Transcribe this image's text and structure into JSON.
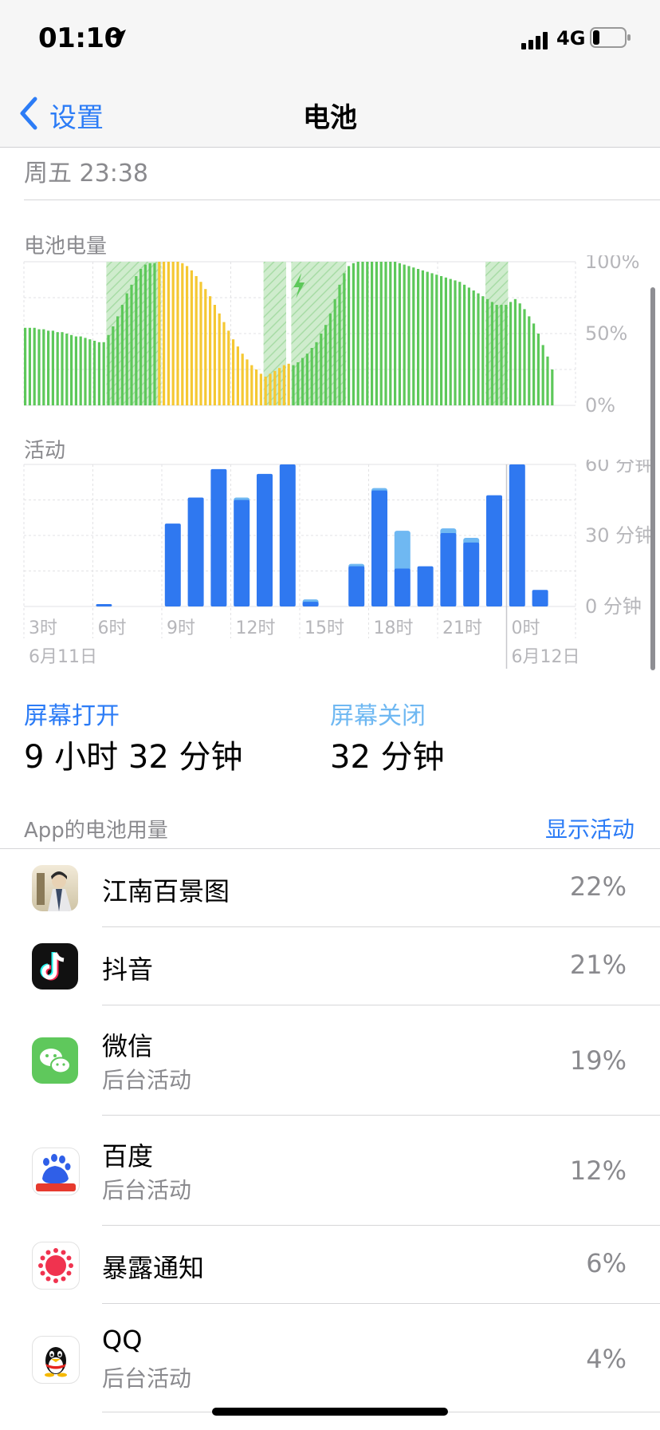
{
  "status_bar": {
    "time": "01:10",
    "network": "4G",
    "icons": [
      "location-arrow-icon",
      "cellular-signal-icon",
      "battery-low-icon"
    ]
  },
  "nav": {
    "back_label": "设置",
    "title": "电池"
  },
  "last_charge": "周五 23:38",
  "colors": {
    "accent": "#2c7cf6",
    "battery_green": "#5dc85a",
    "battery_yellow": "#f5c833",
    "activity_blue": "#2f78f0",
    "activity_light_blue": "#6fb8f2"
  },
  "battery_chart": {
    "label": "电池电量",
    "y_ticks": [
      "100%",
      "50%",
      "0%"
    ]
  },
  "activity_chart": {
    "label": "活动",
    "y_ticks": [
      "60 分钟",
      "30 分钟",
      "0 分钟"
    ],
    "x_ticks": [
      "3时",
      "6时",
      "9时",
      "12时",
      "15时",
      "18时",
      "21时",
      "0时"
    ],
    "dates": [
      "6月11日",
      "6月12日"
    ]
  },
  "chart_data": [
    {
      "type": "bar",
      "title": "电池电量",
      "ylabel": "",
      "y_ticks": [
        "100%",
        "50%",
        "0%"
      ],
      "ylim": [
        0,
        100
      ],
      "values": [
        54,
        54,
        54,
        53,
        53,
        52,
        52,
        51,
        51,
        50,
        49,
        48,
        48,
        47,
        46,
        45,
        44,
        44,
        49,
        55,
        62,
        70,
        78,
        84,
        90,
        95,
        98,
        99,
        99,
        100,
        100,
        100,
        100,
        100,
        99,
        97,
        94,
        90,
        86,
        81,
        76,
        70,
        64,
        58,
        52,
        46,
        41,
        36,
        32,
        28,
        25,
        22,
        20,
        22,
        24,
        26,
        28,
        29,
        28,
        30,
        33,
        36,
        40,
        44,
        50,
        56,
        64,
        74,
        84,
        92,
        97,
        99,
        100,
        100,
        100,
        100,
        100,
        100,
        100,
        100,
        100,
        99,
        98,
        97,
        96,
        95,
        94,
        93,
        92,
        91,
        90,
        89,
        88,
        87,
        86,
        84,
        82,
        80,
        78,
        76,
        74,
        72,
        70,
        70,
        70,
        72,
        74,
        71,
        67,
        62,
        57,
        50,
        42,
        34,
        25
      ],
      "bar_colors": "green 0-28, yellow 29-57, green 58-114 (last bar reached 25%)",
      "charging_hatch_ranges": [
        [
          18,
          29
        ],
        [
          52,
          56
        ],
        [
          58,
          69
        ],
        [
          100,
          104
        ]
      ],
      "charging_icon_at": 59
    },
    {
      "type": "bar",
      "title": "活动",
      "categories": [
        "0时",
        "1时",
        "2时",
        "3时",
        "4时",
        "5时",
        "6时",
        "7时",
        "8时",
        "9时",
        "10时",
        "11时",
        "12时",
        "13时",
        "14时",
        "15时",
        "16时",
        "17时",
        "18时",
        "19时",
        "20时",
        "21时",
        "22时",
        "23时",
        "0时",
        "1时"
      ],
      "x_tick_labels": [
        "3时",
        "6时",
        "9时",
        "12时",
        "15时",
        "18时",
        "21时",
        "0时"
      ],
      "ylabel": "",
      "ylim": [
        0,
        60
      ],
      "y_ticks": [
        "60 分钟",
        "30 分钟",
        "0 分钟"
      ],
      "series": [
        {
          "values": [
            0,
            0,
            0,
            1,
            0,
            0,
            35,
            46,
            58,
            45,
            56,
            60,
            2,
            0,
            17,
            49,
            16,
            17,
            31,
            27,
            47,
            60,
            7,
            0,
            0,
            0
          ]
        },
        {
          "values": [
            0,
            0,
            0,
            0,
            0,
            0,
            0,
            0,
            0,
            1,
            0,
            0,
            1,
            0,
            1,
            1,
            16,
            0,
            2,
            2,
            0,
            0,
            0,
            0,
            0,
            0
          ]
        }
      ]
    }
  ],
  "screen_stats": {
    "on_label": "屏幕打开",
    "on_value": "9 小时 32 分钟",
    "off_label": "屏幕关闭",
    "off_value": "32 分钟"
  },
  "apps_header": {
    "label": "App的电池用量",
    "action": "显示活动"
  },
  "apps": [
    {
      "name": "江南百景图",
      "sub": "",
      "pct": "22%",
      "icon": "jiangnan-app-icon"
    },
    {
      "name": "抖音",
      "sub": "",
      "pct": "21%",
      "icon": "douyin-app-icon"
    },
    {
      "name": "微信",
      "sub": "后台活动",
      "pct": "19%",
      "icon": "wechat-app-icon"
    },
    {
      "name": "百度",
      "sub": "后台活动",
      "pct": "12%",
      "icon": "baidu-app-icon"
    },
    {
      "name": "暴露通知",
      "sub": "",
      "pct": "6%",
      "icon": "exposure-notification-app-icon"
    },
    {
      "name": "QQ",
      "sub": "后台活动",
      "pct": "4%",
      "icon": "qq-app-icon"
    }
  ]
}
